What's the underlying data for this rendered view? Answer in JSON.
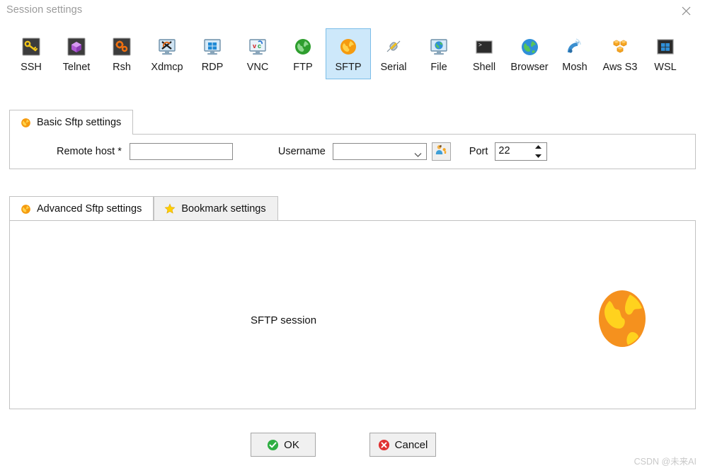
{
  "window": {
    "title": "Session settings",
    "close_icon": "close-icon"
  },
  "session_types": [
    {
      "id": "ssh",
      "label": "SSH",
      "icon": "ssh-key-icon",
      "selected": false
    },
    {
      "id": "telnet",
      "label": "Telnet",
      "icon": "telnet-cube-icon",
      "selected": false
    },
    {
      "id": "rsh",
      "label": "Rsh",
      "icon": "rsh-gears-icon",
      "selected": false
    },
    {
      "id": "xdmcp",
      "label": "Xdmcp",
      "icon": "xdmcp-monitor-icon",
      "selected": false
    },
    {
      "id": "rdp",
      "label": "RDP",
      "icon": "rdp-windows-icon",
      "selected": false
    },
    {
      "id": "vnc",
      "label": "VNC",
      "icon": "vnc-monitor-icon",
      "selected": false
    },
    {
      "id": "ftp",
      "label": "FTP",
      "icon": "ftp-green-globe-icon",
      "selected": false
    },
    {
      "id": "sftp",
      "label": "SFTP",
      "icon": "sftp-orange-globe-icon",
      "selected": true
    },
    {
      "id": "serial",
      "label": "Serial",
      "icon": "serial-plug-icon",
      "selected": false
    },
    {
      "id": "file",
      "label": "File",
      "icon": "file-monitor-globe-icon",
      "selected": false
    },
    {
      "id": "shell",
      "label": "Shell",
      "icon": "shell-terminal-icon",
      "selected": false
    },
    {
      "id": "browser",
      "label": "Browser",
      "icon": "browser-globe-icon",
      "selected": false
    },
    {
      "id": "mosh",
      "label": "Mosh",
      "icon": "mosh-satellite-icon",
      "selected": false
    },
    {
      "id": "awss3",
      "label": "Aws S3",
      "icon": "aws-s3-cubes-icon",
      "selected": false
    },
    {
      "id": "wsl",
      "label": "WSL",
      "icon": "wsl-windows-icon",
      "selected": false
    }
  ],
  "basic_settings": {
    "tab_label": "Basic Sftp settings",
    "tab_icon": "orange-globe-icon",
    "remote_host": {
      "label": "Remote host *",
      "value": "",
      "placeholder": ""
    },
    "username": {
      "label": "Username",
      "value": "",
      "options": []
    },
    "credentials_button": {
      "icon": "user-key-icon",
      "label": ""
    },
    "port": {
      "label": "Port",
      "value": "22"
    }
  },
  "lower_tabs": [
    {
      "id": "advanced",
      "label": "Advanced Sftp settings",
      "icon": "orange-globe-icon",
      "active": true
    },
    {
      "id": "bookmark",
      "label": "Bookmark settings",
      "icon": "yellow-star-icon",
      "active": false
    }
  ],
  "lower_panel": {
    "session_text": "SFTP session",
    "illustration_icon": "orange-globe-large-icon"
  },
  "footer": {
    "ok_label": "OK",
    "ok_icon": "green-check-icon",
    "cancel_label": "Cancel",
    "cancel_icon": "red-x-icon"
  },
  "watermark": "CSDN @未来AI",
  "colors": {
    "selection_bg": "#cde8fa",
    "selection_border": "#7bbde8",
    "orange": "#f59b1c",
    "yellow": "#ffcf00",
    "green": "#3aa93a",
    "red": "#e03a3a",
    "panel_border": "#c2c2c2"
  }
}
